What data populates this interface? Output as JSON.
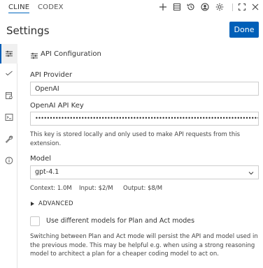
{
  "tabs": [
    {
      "label": "CLINE",
      "active": true
    },
    {
      "label": "CODEX",
      "active": false
    }
  ],
  "toolbar_icons": [
    "plus-icon",
    "history-list-icon",
    "restore-icon",
    "account-icon",
    "gear-icon",
    "expand-icon",
    "close-icon"
  ],
  "header": {
    "title": "Settings",
    "done_label": "Done"
  },
  "rail_icons": [
    "sliders-icon",
    "check-icon",
    "browser-icon",
    "terminal-icon",
    "wrench-icon",
    "info-icon"
  ],
  "section": {
    "title": "API Configuration"
  },
  "provider": {
    "label": "API Provider",
    "value": "OpenAI"
  },
  "api_key": {
    "label": "OpenAI API Key",
    "value": "•••••••••••••••••••••••••••••••••••••••••••••••••••••••••••••••••••••••••••••••••••••••••••••••••••••••••••••",
    "hint": "This key is stored locally and only used to make API requests from this extension."
  },
  "model": {
    "label": "Model",
    "value": "gpt-4.1",
    "context": "Context: 1.0M",
    "input_price": "Input: $2/M",
    "output_price": "Output: $8/M"
  },
  "advanced": {
    "label": "ADVANCED"
  },
  "plan_act": {
    "label": "Use different models for Plan and Act modes",
    "checked": false,
    "hint": "Switching between Plan and Act mode will persist the API and model used in the previous mode. This may be helpful e.g. when using a strong reasoning model to architect a plan for a cheaper coding model to act on."
  },
  "colors": {
    "accent": "#005fb8",
    "text": "#333333",
    "border": "#cecece"
  }
}
